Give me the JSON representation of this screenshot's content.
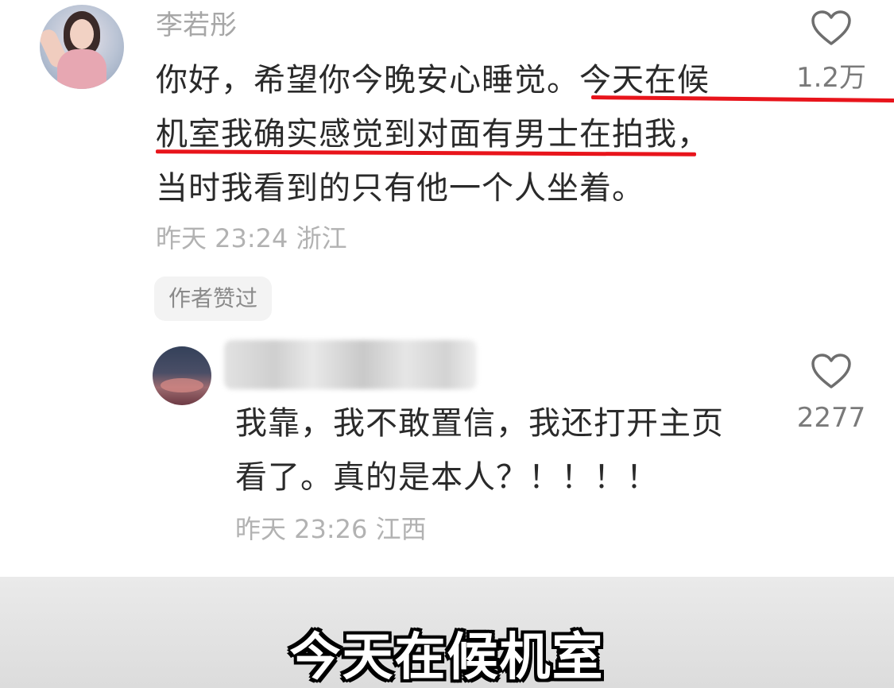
{
  "main_comment": {
    "username": "李若彤",
    "lines": [
      "你好，希望你今晚安心睡觉。今天在候",
      "机室我确实感觉到对面有男士在拍我，",
      "当时我看到的只有他一个人坐着。"
    ],
    "meta": "昨天 23:24 浙江",
    "badge": "作者赞过",
    "like_count": "1.2万",
    "like_icon": "heart-outline-icon"
  },
  "reply_comment": {
    "lines": [
      "我靠，我不敢置信，我还打开主页",
      "看了。真的是本人？！！！！"
    ],
    "meta": "昨天 23:26 江西",
    "like_count": "2277",
    "like_icon": "heart-outline-icon"
  },
  "subtitle": "今天在候机室",
  "colors": {
    "underline": "#e8141b",
    "meta_text": "#b2b2b2",
    "body_text": "#2a2a2a"
  }
}
